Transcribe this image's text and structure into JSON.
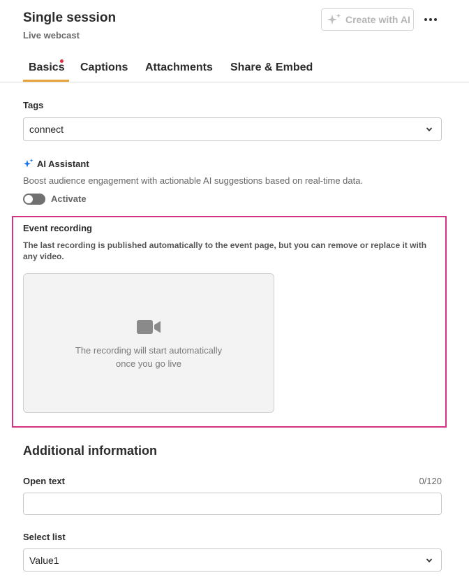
{
  "header": {
    "title": "Single session",
    "subtitle": "Live webcast",
    "ai_button_label": "Create with AI",
    "ai_button_icon": "sparkle-icon",
    "more_icon": "more-horizontal-icon"
  },
  "tabs": [
    {
      "label": "Basics",
      "active": true,
      "has_notification": true
    },
    {
      "label": "Captions",
      "active": false
    },
    {
      "label": "Attachments",
      "active": false
    },
    {
      "label": "Share & Embed",
      "active": false
    }
  ],
  "tags": {
    "label": "Tags",
    "value": "connect"
  },
  "ai_assistant": {
    "title": "AI Assistant",
    "description": "Boost audience engagement with actionable AI suggestions based on real-time data.",
    "toggle_label": "Activate",
    "enabled": false
  },
  "event_recording": {
    "title": "Event recording",
    "description": "The last recording is published automatically to the event page, but you can remove or replace it with any video.",
    "placeholder_line1": "The recording will start automatically",
    "placeholder_line2": "once you go live",
    "icon": "video-camera-icon"
  },
  "additional_info": {
    "title": "Additional information",
    "open_text": {
      "label": "Open text",
      "counter": "0/120",
      "value": ""
    },
    "select_list": {
      "label": "Select list",
      "value": "Value1"
    }
  },
  "colors": {
    "tab_underline": "#e8a23a",
    "notification_dot": "#e0303c",
    "highlight_border": "#d63384",
    "ai_spark_blue": "#1a73e8"
  }
}
